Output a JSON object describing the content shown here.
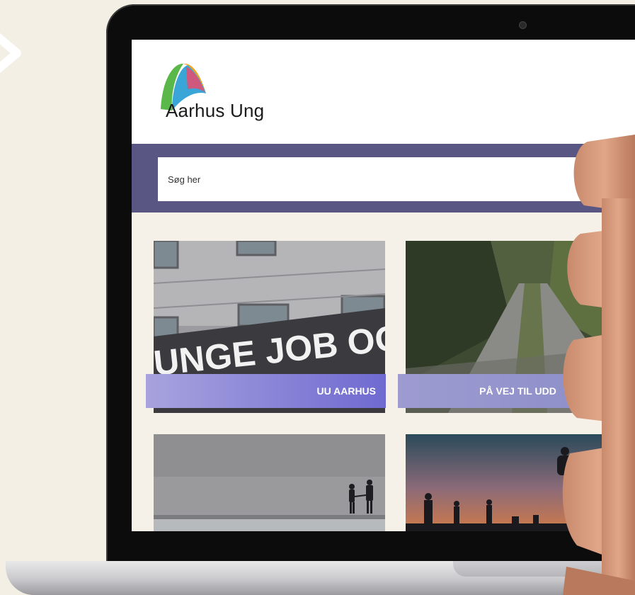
{
  "site": {
    "logo_text": "Aarhus Ung"
  },
  "search": {
    "placeholder": "Søg her"
  },
  "tiles": [
    {
      "label": "UU AARHUS",
      "image_sign_text": "UNGE JOB OG"
    },
    {
      "label": "PÅ VEJ TIL UDD"
    },
    {
      "label": ""
    },
    {
      "label": ""
    }
  ],
  "colors": {
    "page_bg": "#f3efe4",
    "search_band": "#5a5683",
    "screen_bg": "#f6f1e8",
    "label_gradient_start": "#a8a3de",
    "label_gradient_end": "#6f6ad0"
  },
  "icons": [
    "chevron-right-icon",
    "aarhus-ung-logo-icon",
    "camera-icon"
  ]
}
